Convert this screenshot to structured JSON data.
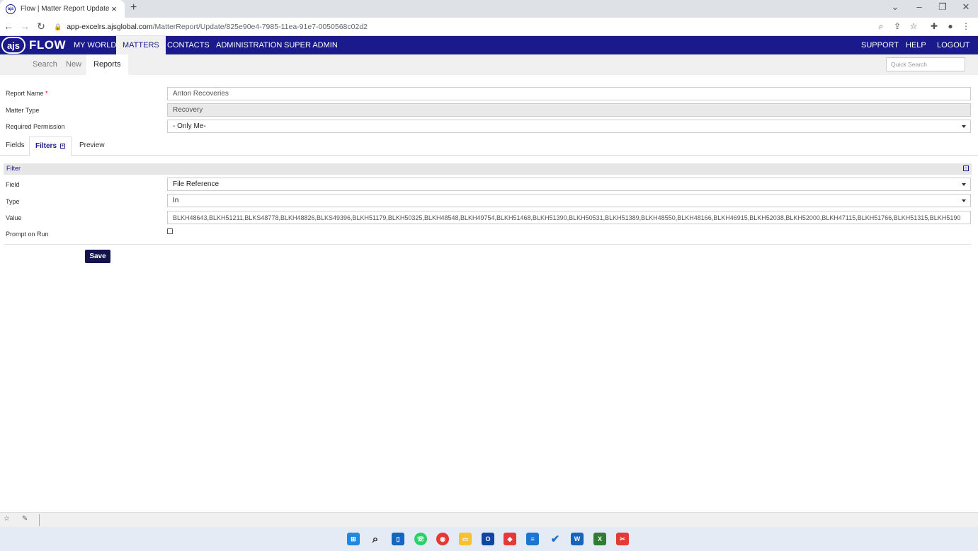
{
  "browser": {
    "tab_title": "Flow | Matter Report Update",
    "url_host": "app-excelrs.ajsglobal.com",
    "url_path": "/MatterReport/Update/825e90e4-7985-11ea-91e7-0050568c02d2"
  },
  "app": {
    "logo_mark": "ajs",
    "logo_text": "FLOW",
    "nav": [
      "MY WORLD",
      "MATTERS",
      "CONTACTS",
      "ADMINISTRATION",
      "SUPER ADMIN"
    ],
    "nav_right": [
      "SUPPORT",
      "HELP",
      "LOGOUT"
    ],
    "subnav": [
      "Search",
      "New",
      "Reports"
    ],
    "quick_search_placeholder": "Quick Search"
  },
  "form": {
    "report_name_label": "Report Name",
    "required_marker": "*",
    "report_name_value": "Anton Recoveries",
    "matter_type_label": "Matter Type",
    "matter_type_value": "Recovery",
    "permission_label": "Required Permission",
    "permission_value": "- Only Me-"
  },
  "tabs": {
    "fields": "Fields",
    "filters": "Filters",
    "preview": "Preview"
  },
  "filter": {
    "title": "Filter",
    "field_label": "Field",
    "field_value": "File Reference",
    "type_label": "Type",
    "type_value": "In",
    "value_label": "Value",
    "value_value": "BLKH48643,BLKH51211,BLKS48778,BLKH48826,BLKS49396,BLKH51179,BLKH50325,BLKH48548,BLKH49754,BLKH51468,BLKH51390,BLKH50531,BLKH51389,BLKH48550,BLKH48166,BLKH46915,BLKH52038,BLKH52000,BLKH47115,BLKH51766,BLKH51315,BLKH5190",
    "prompt_label": "Prompt on Run",
    "save_label": "Save"
  }
}
